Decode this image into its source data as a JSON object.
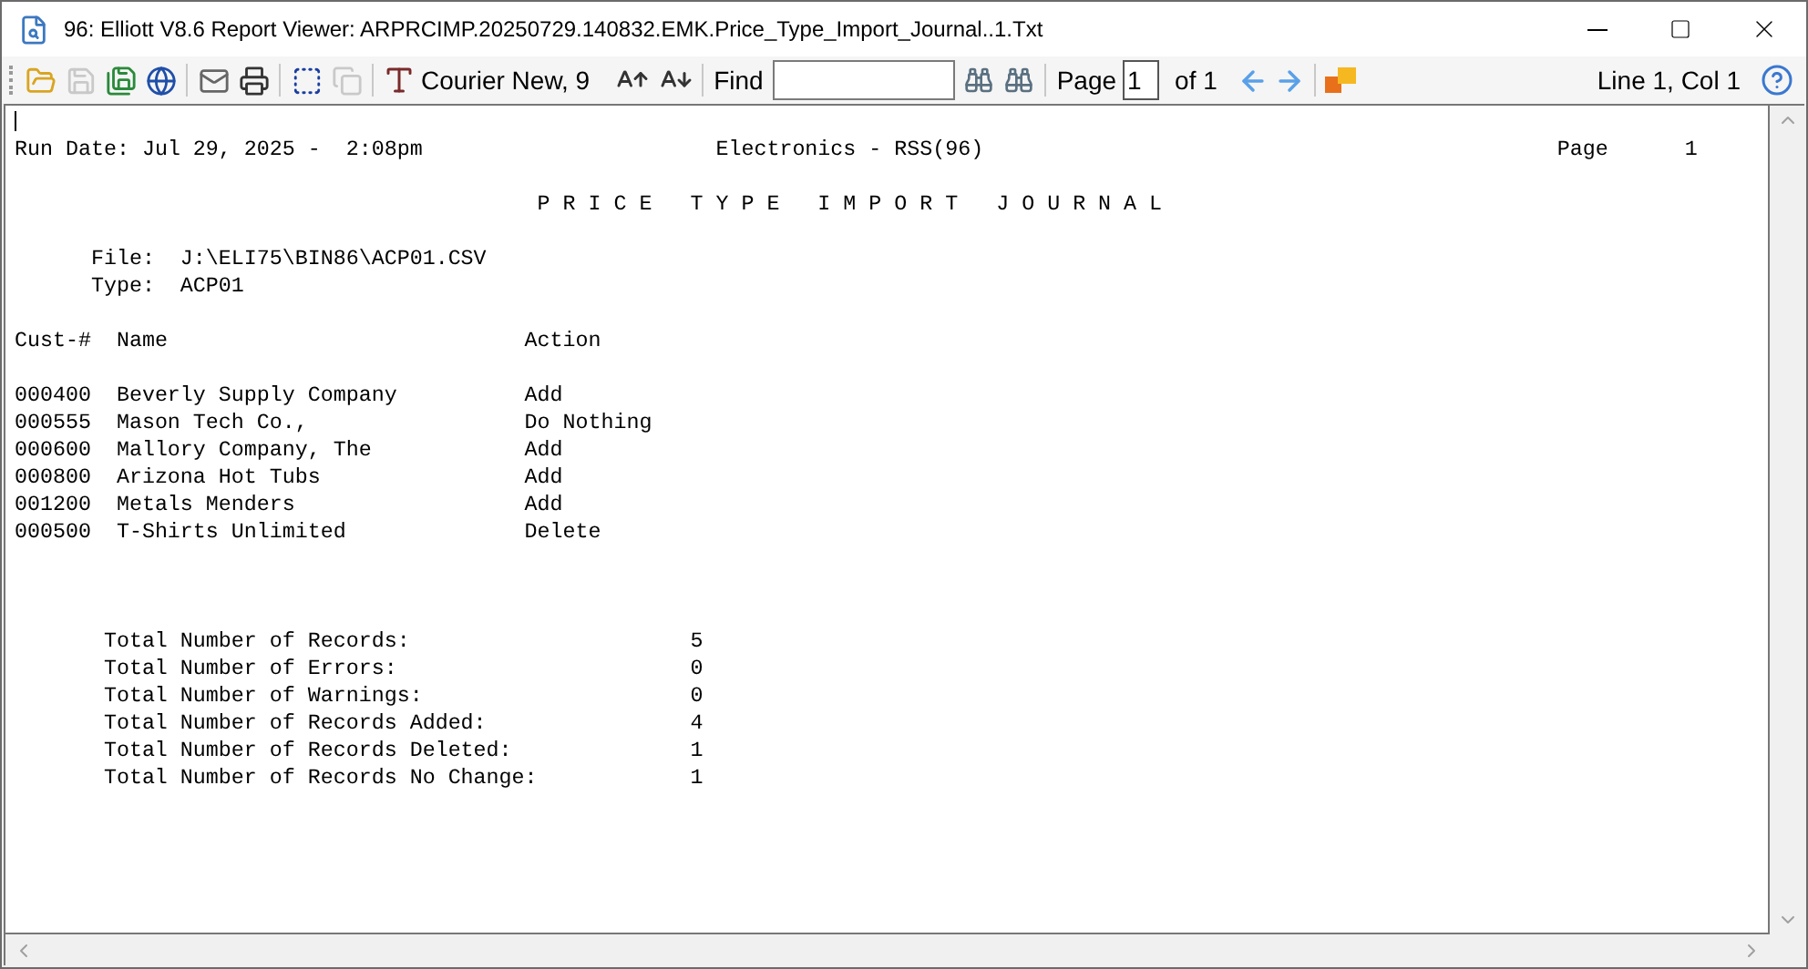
{
  "window": {
    "title": "96: Elliott V8.6 Report Viewer: ARPRCIMP.20250729.140832.EMK.Price_Type_Import_Journal..1.Txt"
  },
  "toolbar": {
    "buttons_a": [
      {
        "kind": "open",
        "disabled": false
      },
      {
        "kind": "save",
        "disabled": true
      },
      {
        "kind": "save-as",
        "disabled": false
      },
      {
        "kind": "web",
        "disabled": false
      }
    ],
    "buttons_b": [
      {
        "kind": "mail",
        "disabled": false
      },
      {
        "kind": "print",
        "disabled": false
      }
    ],
    "buttons_c": [
      {
        "kind": "select-all",
        "disabled": false
      },
      {
        "kind": "copy",
        "disabled": true
      }
    ],
    "font": "Courier New, 9",
    "find_label": "Find",
    "page_label": "Page",
    "page_value": "1",
    "page_of": "of 1",
    "position": "Line 1, Col 1"
  },
  "report": {
    "run_date": "Run Date: Jul 29, 2025 -  2:08pm",
    "company": "Electronics - RSS(96)",
    "page_label": "Page",
    "page_number": "1",
    "title": "P R I C E   T Y P E   I M P O R T   J O U R N A L",
    "file_label": "File:",
    "file_value": "J:\\ELI75\\BIN86\\ACP01.CSV",
    "type_label": "Type:",
    "type_value": "ACP01",
    "columns": [
      "Cust-#",
      "Name",
      "Action"
    ],
    "rows": [
      {
        "cust": "000400",
        "name": "Beverly Supply Company",
        "action": "Add"
      },
      {
        "cust": "000555",
        "name": "Mason Tech Co.,",
        "action": "Do Nothing"
      },
      {
        "cust": "000600",
        "name": "Mallory Company, The",
        "action": "Add"
      },
      {
        "cust": "000800",
        "name": "Arizona Hot Tubs",
        "action": "Add"
      },
      {
        "cust": "001200",
        "name": "Metals Menders",
        "action": "Add"
      },
      {
        "cust": "000500",
        "name": "T-Shirts Unlimited",
        "action": "Delete"
      }
    ],
    "totals": [
      {
        "label": "Total Number of Records:",
        "value": "5"
      },
      {
        "label": "Total Number of Errors:",
        "value": "0"
      },
      {
        "label": "Total Number of Warnings:",
        "value": "0"
      },
      {
        "label": "Total Number of Records Added:",
        "value": "4"
      },
      {
        "label": "Total Number of Records Deleted:",
        "value": "1"
      },
      {
        "label": "Total Number of Records No Change:",
        "value": "1"
      }
    ]
  }
}
